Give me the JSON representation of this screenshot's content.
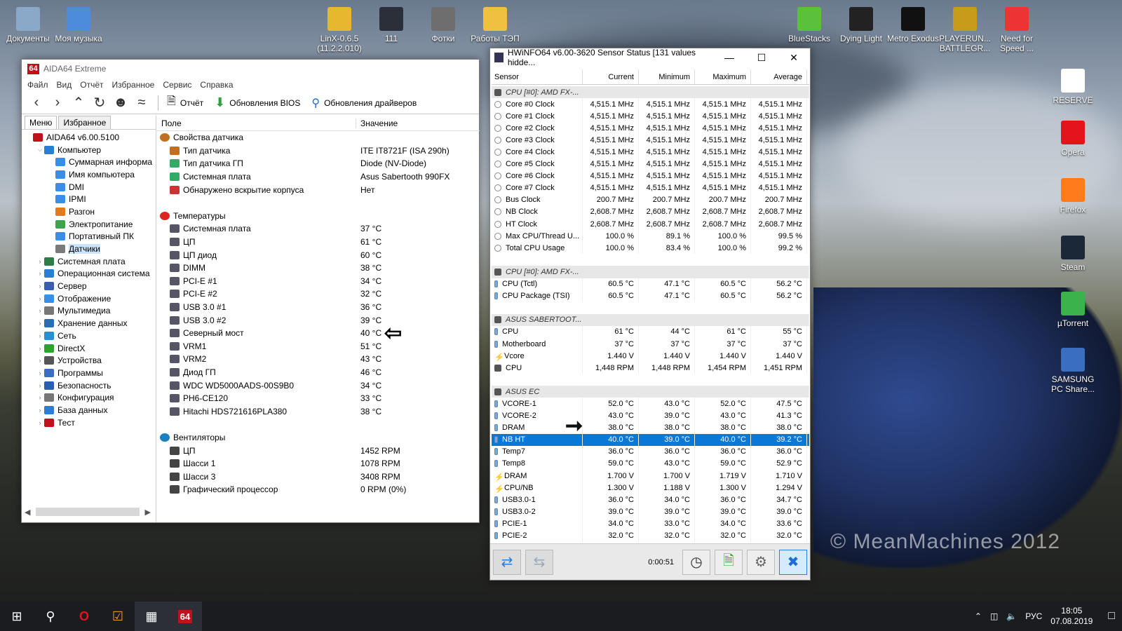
{
  "desktop_icons": [
    {
      "label": "Документы",
      "x": "left"
    },
    {
      "label": "Моя музыка"
    },
    {
      "label": "LinX-0.6.5\n(11.2.2.010)"
    },
    {
      "label": "111"
    },
    {
      "label": "Фотки"
    },
    {
      "label": "Работы ТЭП"
    },
    {
      "label": "BlueStacks"
    },
    {
      "label": "Dying Light"
    },
    {
      "label": "Metro Exodus"
    },
    {
      "label": "PLAYERUN... BATTLEGR..."
    },
    {
      "label": "Need for Speed ..."
    },
    {
      "label": "RESERVE"
    },
    {
      "label": "Opera"
    },
    {
      "label": "Firefox"
    },
    {
      "label": "Steam"
    },
    {
      "label": "µTorrent"
    },
    {
      "label": "SAMSUNG PC Share..."
    }
  ],
  "aida": {
    "title": "AIDA64 Extreme",
    "logo": "64",
    "menu": [
      "Файл",
      "Вид",
      "Отчёт",
      "Избранное",
      "Сервис",
      "Справка"
    ],
    "toolbar": {
      "report": "Отчёт",
      "bios": "Обновления BIOS",
      "drivers": "Обновления драйверов"
    },
    "tabs": [
      "Меню",
      "Избранное"
    ],
    "tree": [
      {
        "label": "AIDA64 v6.00.5100",
        "indent": 0,
        "exp": ""
      },
      {
        "label": "Компьютер",
        "indent": 1,
        "exp": "v"
      },
      {
        "label": "Суммарная информа",
        "indent": 2,
        "exp": ""
      },
      {
        "label": "Имя компьютера",
        "indent": 2,
        "exp": ""
      },
      {
        "label": "DMI",
        "indent": 2,
        "exp": ""
      },
      {
        "label": "IPMI",
        "indent": 2,
        "exp": ""
      },
      {
        "label": "Разгон",
        "indent": 2,
        "exp": ""
      },
      {
        "label": "Электропитание",
        "indent": 2,
        "exp": ""
      },
      {
        "label": "Портативный ПК",
        "indent": 2,
        "exp": ""
      },
      {
        "label": "Датчики",
        "indent": 2,
        "exp": "",
        "sel": true
      },
      {
        "label": "Системная плата",
        "indent": 1,
        "exp": ">"
      },
      {
        "label": "Операционная система",
        "indent": 1,
        "exp": ">"
      },
      {
        "label": "Сервер",
        "indent": 1,
        "exp": ">"
      },
      {
        "label": "Отображение",
        "indent": 1,
        "exp": ">"
      },
      {
        "label": "Мультимедиа",
        "indent": 1,
        "exp": ">"
      },
      {
        "label": "Хранение данных",
        "indent": 1,
        "exp": ">"
      },
      {
        "label": "Сеть",
        "indent": 1,
        "exp": ">"
      },
      {
        "label": "DirectX",
        "indent": 1,
        "exp": ">"
      },
      {
        "label": "Устройства",
        "indent": 1,
        "exp": ">"
      },
      {
        "label": "Программы",
        "indent": 1,
        "exp": ">"
      },
      {
        "label": "Безопасность",
        "indent": 1,
        "exp": ">"
      },
      {
        "label": "Конфигурация",
        "indent": 1,
        "exp": ">"
      },
      {
        "label": "База данных",
        "indent": 1,
        "exp": ">"
      },
      {
        "label": "Тест",
        "indent": 1,
        "exp": ">"
      }
    ],
    "cols": {
      "field": "Поле",
      "value": "Значение"
    },
    "groups": [
      {
        "name": "Свойства датчика",
        "rows": [
          {
            "f": "Тип датчика",
            "v": "ITE IT8721F  (ISA 290h)"
          },
          {
            "f": "Тип датчика ГП",
            "v": "Diode  (NV-Diode)"
          },
          {
            "f": "Системная плата",
            "v": "Asus Sabertooth 990FX"
          },
          {
            "f": "Обнаружено вскрытие корпуса",
            "v": "Нет"
          }
        ]
      },
      {
        "name": "Температуры",
        "rows": [
          {
            "f": "Системная плата",
            "v": "37 °C"
          },
          {
            "f": "ЦП",
            "v": "61 °C"
          },
          {
            "f": "ЦП диод",
            "v": "60 °C"
          },
          {
            "f": "DIMM",
            "v": "38 °C"
          },
          {
            "f": "PCI-E #1",
            "v": "34 °C"
          },
          {
            "f": "PCI-E #2",
            "v": "32 °C"
          },
          {
            "f": "USB 3.0 #1",
            "v": "36 °C"
          },
          {
            "f": "USB 3.0 #2",
            "v": "39 °C"
          },
          {
            "f": "Северный мост",
            "v": "40 °C"
          },
          {
            "f": "VRM1",
            "v": "51 °C"
          },
          {
            "f": "VRM2",
            "v": "43 °C"
          },
          {
            "f": "Диод ГП",
            "v": "46 °C"
          },
          {
            "f": "WDC WD5000AADS-00S9B0",
            "v": "34 °C"
          },
          {
            "f": "PH6-CE120",
            "v": "33 °C"
          },
          {
            "f": "Hitachi HDS721616PLA380",
            "v": "38 °C"
          }
        ]
      },
      {
        "name": "Вентиляторы",
        "rows": [
          {
            "f": "ЦП",
            "v": "1452 RPM"
          },
          {
            "f": "Шасси 1",
            "v": "1078 RPM"
          },
          {
            "f": "Шасси 3",
            "v": "3408 RPM"
          },
          {
            "f": "Графический процессор",
            "v": "0 RPM  (0%)"
          }
        ]
      }
    ]
  },
  "hwinfo": {
    "title": "HWiNFO64 v6.00-3620 Sensor Status [131 values hidde...",
    "cols": [
      "Sensor",
      "Current",
      "Minimum",
      "Maximum",
      "Average"
    ],
    "rows": [
      {
        "g": "CPU [#0]: AMD FX-..."
      },
      {
        "s": "Core #0 Clock",
        "c": "4,515.1 MHz",
        "mi": "4,515.1 MHz",
        "ma": "4,515.1 MHz",
        "a": "4,515.1 MHz",
        "i": "o"
      },
      {
        "s": "Core #1 Clock",
        "c": "4,515.1 MHz",
        "mi": "4,515.1 MHz",
        "ma": "4,515.1 MHz",
        "a": "4,515.1 MHz",
        "i": "o"
      },
      {
        "s": "Core #2 Clock",
        "c": "4,515.1 MHz",
        "mi": "4,515.1 MHz",
        "ma": "4,515.1 MHz",
        "a": "4,515.1 MHz",
        "i": "o"
      },
      {
        "s": "Core #3 Clock",
        "c": "4,515.1 MHz",
        "mi": "4,515.1 MHz",
        "ma": "4,515.1 MHz",
        "a": "4,515.1 MHz",
        "i": "o"
      },
      {
        "s": "Core #4 Clock",
        "c": "4,515.1 MHz",
        "mi": "4,515.1 MHz",
        "ma": "4,515.1 MHz",
        "a": "4,515.1 MHz",
        "i": "o"
      },
      {
        "s": "Core #5 Clock",
        "c": "4,515.1 MHz",
        "mi": "4,515.1 MHz",
        "ma": "4,515.1 MHz",
        "a": "4,515.1 MHz",
        "i": "o"
      },
      {
        "s": "Core #6 Clock",
        "c": "4,515.1 MHz",
        "mi": "4,515.1 MHz",
        "ma": "4,515.1 MHz",
        "a": "4,515.1 MHz",
        "i": "o"
      },
      {
        "s": "Core #7 Clock",
        "c": "4,515.1 MHz",
        "mi": "4,515.1 MHz",
        "ma": "4,515.1 MHz",
        "a": "4,515.1 MHz",
        "i": "o"
      },
      {
        "s": "Bus Clock",
        "c": "200.7 MHz",
        "mi": "200.7 MHz",
        "ma": "200.7 MHz",
        "a": "200.7 MHz",
        "i": "o"
      },
      {
        "s": "NB Clock",
        "c": "2,608.7 MHz",
        "mi": "2,608.7 MHz",
        "ma": "2,608.7 MHz",
        "a": "2,608.7 MHz",
        "i": "o"
      },
      {
        "s": "HT Clock",
        "c": "2,608.7 MHz",
        "mi": "2,608.7 MHz",
        "ma": "2,608.7 MHz",
        "a": "2,608.7 MHz",
        "i": "o"
      },
      {
        "s": "Max CPU/Thread U...",
        "c": "100.0 %",
        "mi": "89.1 %",
        "ma": "100.0 %",
        "a": "99.5 %",
        "i": "o"
      },
      {
        "s": "Total CPU Usage",
        "c": "100.0 %",
        "mi": "83.4 %",
        "ma": "100.0 %",
        "a": "99.2 %",
        "i": "o"
      },
      {
        "blank": true
      },
      {
        "g": "CPU [#0]: AMD FX-..."
      },
      {
        "s": "CPU (Tctl)",
        "c": "60.5 °C",
        "mi": "47.1 °C",
        "ma": "60.5 °C",
        "a": "56.2 °C",
        "i": "t"
      },
      {
        "s": "CPU Package (TSI)",
        "c": "60.5 °C",
        "mi": "47.1 °C",
        "ma": "60.5 °C",
        "a": "56.2 °C",
        "i": "t"
      },
      {
        "blank": true
      },
      {
        "g": "ASUS SABERTOOT..."
      },
      {
        "s": "CPU",
        "c": "61 °C",
        "mi": "44 °C",
        "ma": "61 °C",
        "a": "55 °C",
        "i": "t"
      },
      {
        "s": "Motherboard",
        "c": "37 °C",
        "mi": "37 °C",
        "ma": "37 °C",
        "a": "37 °C",
        "i": "t"
      },
      {
        "s": "Vcore",
        "c": "1.440 V",
        "mi": "1.440 V",
        "ma": "1.440 V",
        "a": "1.440 V",
        "i": "v"
      },
      {
        "s": "CPU",
        "c": "1,448 RPM",
        "mi": "1,448 RPM",
        "ma": "1,454 RPM",
        "a": "1,451 RPM",
        "i": "g"
      },
      {
        "blank": true
      },
      {
        "g": "ASUS EC"
      },
      {
        "s": "VCORE-1",
        "c": "52.0 °C",
        "mi": "43.0 °C",
        "ma": "52.0 °C",
        "a": "47.5 °C",
        "i": "t"
      },
      {
        "s": "VCORE-2",
        "c": "43.0 °C",
        "mi": "39.0 °C",
        "ma": "43.0 °C",
        "a": "41.3 °C",
        "i": "t"
      },
      {
        "s": "DRAM",
        "c": "38.0 °C",
        "mi": "38.0 °C",
        "ma": "38.0 °C",
        "a": "38.0 °C",
        "i": "t"
      },
      {
        "s": "NB HT",
        "c": "40.0 °C",
        "mi": "39.0 °C",
        "ma": "40.0 °C",
        "a": "39.2 °C",
        "i": "t",
        "sel": true
      },
      {
        "s": "Temp7",
        "c": "36.0 °C",
        "mi": "36.0 °C",
        "ma": "36.0 °C",
        "a": "36.0 °C",
        "i": "t"
      },
      {
        "s": "Temp8",
        "c": "59.0 °C",
        "mi": "43.0 °C",
        "ma": "59.0 °C",
        "a": "52.9 °C",
        "i": "t"
      },
      {
        "s": "DRAM",
        "c": "1.700 V",
        "mi": "1.700 V",
        "ma": "1.719 V",
        "a": "1.710 V",
        "i": "v"
      },
      {
        "s": "CPU/NB",
        "c": "1.300 V",
        "mi": "1.188 V",
        "ma": "1.300 V",
        "a": "1.294 V",
        "i": "v"
      },
      {
        "s": "USB3.0-1",
        "c": "36.0 °C",
        "mi": "34.0 °C",
        "ma": "36.0 °C",
        "a": "34.7 °C",
        "i": "t"
      },
      {
        "s": "USB3.0-2",
        "c": "39.0 °C",
        "mi": "39.0 °C",
        "ma": "39.0 °C",
        "a": "39.0 °C",
        "i": "t"
      },
      {
        "s": "PCIE-1",
        "c": "34.0 °C",
        "mi": "33.0 °C",
        "ma": "34.0 °C",
        "a": "33.6 °C",
        "i": "t"
      },
      {
        "s": "PCIE-2",
        "c": "32.0 °C",
        "mi": "32.0 °C",
        "ma": "32.0 °C",
        "a": "32.0 °C",
        "i": "t"
      }
    ],
    "timer": "0:00:51"
  },
  "watermark": "© MeanMachines 2012",
  "taskbar": {
    "lang": "РУС",
    "time": "18:05",
    "date": "07.08.2019",
    "aida_label": "64"
  }
}
